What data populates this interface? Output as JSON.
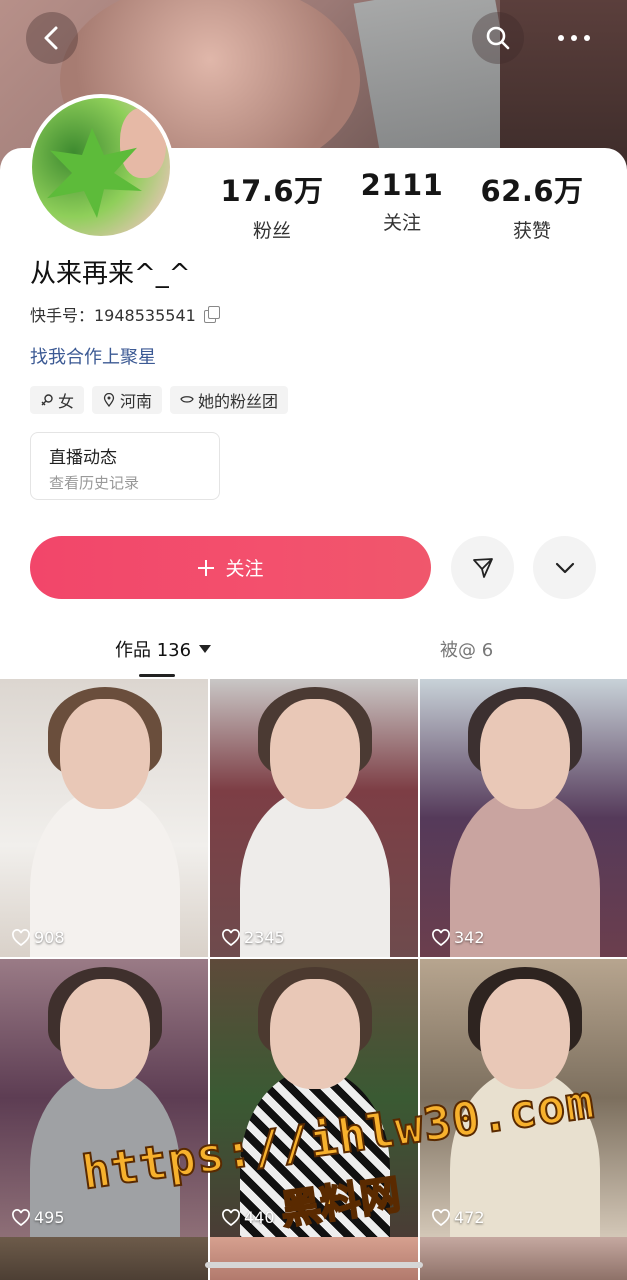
{
  "header": {
    "back_icon": "chevron-left-icon",
    "search_icon": "search-icon",
    "more_icon": "more-horizontal-icon"
  },
  "profile": {
    "stats": [
      {
        "value": "17.6万",
        "label": "粉丝"
      },
      {
        "value": "2111",
        "label": "关注"
      },
      {
        "value": "62.6万",
        "label": "获赞"
      }
    ],
    "name": "从来再来^_^",
    "uid": "快手号：1948535541",
    "business_link": "找我合作上聚星",
    "tags": [
      {
        "icon": "female-icon",
        "label": "女"
      },
      {
        "icon": "location-icon",
        "label": "河南"
      },
      {
        "icon": "fan-club-icon",
        "label": "她的粉丝团"
      }
    ],
    "live_card": {
      "title": "直播动态",
      "subtitle": "查看历史记录"
    }
  },
  "actions": {
    "follow_label": "关注",
    "accent": "#f2466a"
  },
  "tabs": {
    "works": "作品 136",
    "mentioned": "被@ 6"
  },
  "videos": [
    {
      "likes": "908"
    },
    {
      "likes": "2345"
    },
    {
      "likes": "342"
    },
    {
      "likes": "495"
    },
    {
      "likes": "440"
    },
    {
      "likes": "472"
    }
  ],
  "watermark": {
    "url": "https://ihlw30.com",
    "site": "黑料网"
  }
}
